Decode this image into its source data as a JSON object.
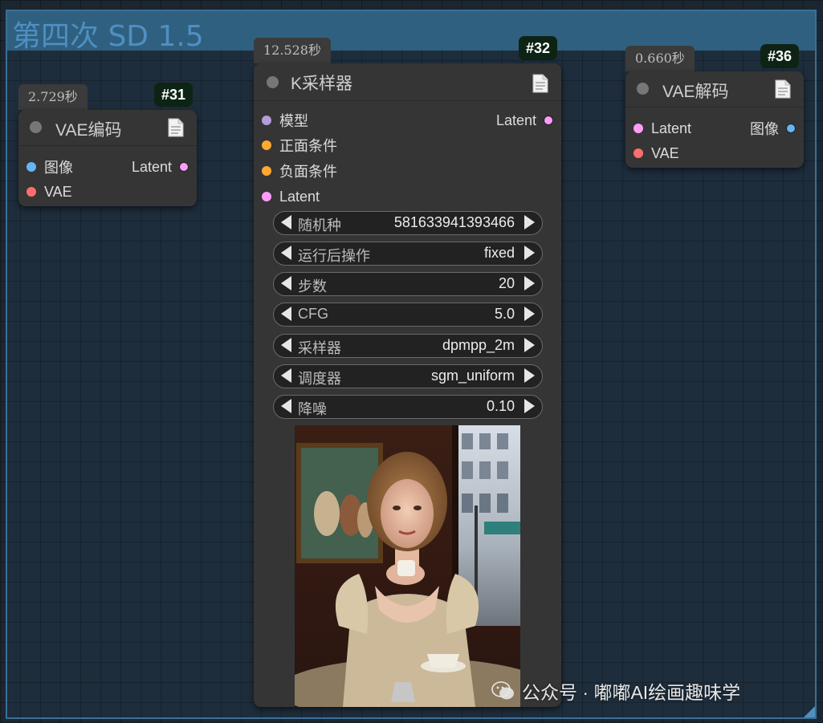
{
  "group": {
    "title": "第四次 SD 1.5"
  },
  "colors": {
    "slot_model": "#b39ddb",
    "slot_conditioning": "#ffa931",
    "slot_latent": "#ff9cf9",
    "slot_image": "#64b5f6",
    "slot_vae": "#ff6e6e"
  },
  "nodes": {
    "vae_encode": {
      "time": "2.729秒",
      "id": "#31",
      "title": "VAE编码",
      "inputs": [
        "图像",
        "VAE"
      ],
      "outputs": [
        "Latent"
      ]
    },
    "ksampler": {
      "time": "12.528秒",
      "id": "#32",
      "title": "K采样器",
      "inputs": [
        "模型",
        "正面条件",
        "负面条件",
        "Latent"
      ],
      "outputs": [
        "Latent"
      ],
      "widgets": [
        {
          "name": "随机种",
          "value": "581633941393466"
        },
        {
          "name": "运行后操作",
          "value": "fixed"
        },
        {
          "name": "步数",
          "value": "20"
        },
        {
          "name": "CFG",
          "value": "5.0"
        },
        {
          "name": "采样器",
          "value": "dpmpp_2m"
        },
        {
          "name": "调度器",
          "value": "sgm_uniform"
        },
        {
          "name": "降噪",
          "value": "0.10"
        }
      ]
    },
    "vae_decode": {
      "time": "0.660秒",
      "id": "#36",
      "title": "VAE解码",
      "inputs": [
        "Latent",
        "VAE"
      ],
      "outputs": [
        "图像"
      ]
    }
  },
  "watermark": {
    "text": "公众号 · 嘟嘟AI绘画趣味学"
  },
  "icons": {
    "node_menu": "document-icon",
    "preview": "generated-image-preview",
    "watermark": "wechat-logo-icon"
  }
}
